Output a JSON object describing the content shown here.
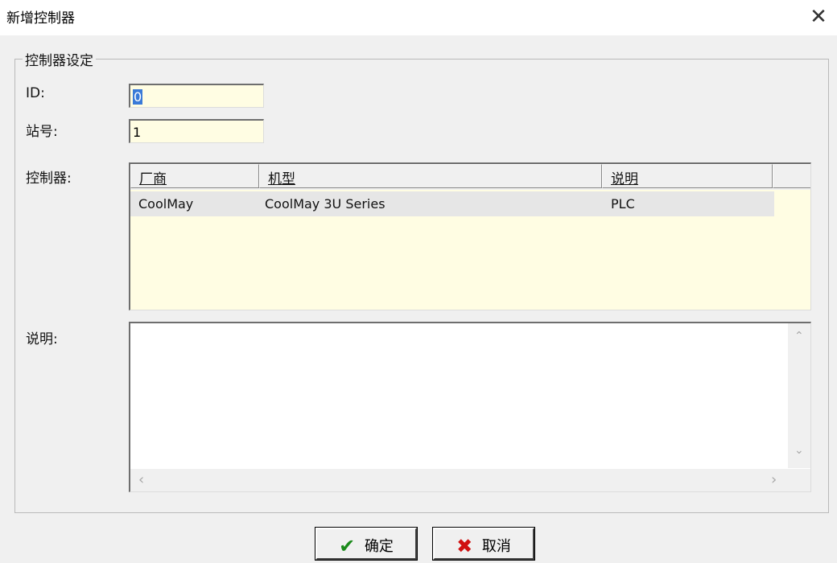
{
  "window": {
    "title": "新增控制器",
    "close_glyph": "✕"
  },
  "group": {
    "legend": "控制器设定"
  },
  "fields": {
    "id_label": "ID:",
    "id_value": "0",
    "station_label": "站号:",
    "station_value": "1",
    "controller_label": "控制器:",
    "description_label": "说明:"
  },
  "controller_list": {
    "columns": [
      "厂商",
      "机型",
      "说明"
    ],
    "rows": [
      {
        "vendor": "CoolMay",
        "model": "CoolMay 3U Series",
        "note": "PLC"
      }
    ]
  },
  "memo": {
    "value": ""
  },
  "buttons": {
    "ok": {
      "label": "确定",
      "icon": "check-icon",
      "icon_glyph": "✔",
      "icon_color": "#1a8a1a"
    },
    "cancel": {
      "label": "取消",
      "icon": "x-icon",
      "icon_glyph": "✖",
      "icon_color": "#d01010"
    }
  },
  "scroll_glyphs": {
    "up": "⌃",
    "down": "⌄",
    "left": "‹",
    "right": "›"
  }
}
